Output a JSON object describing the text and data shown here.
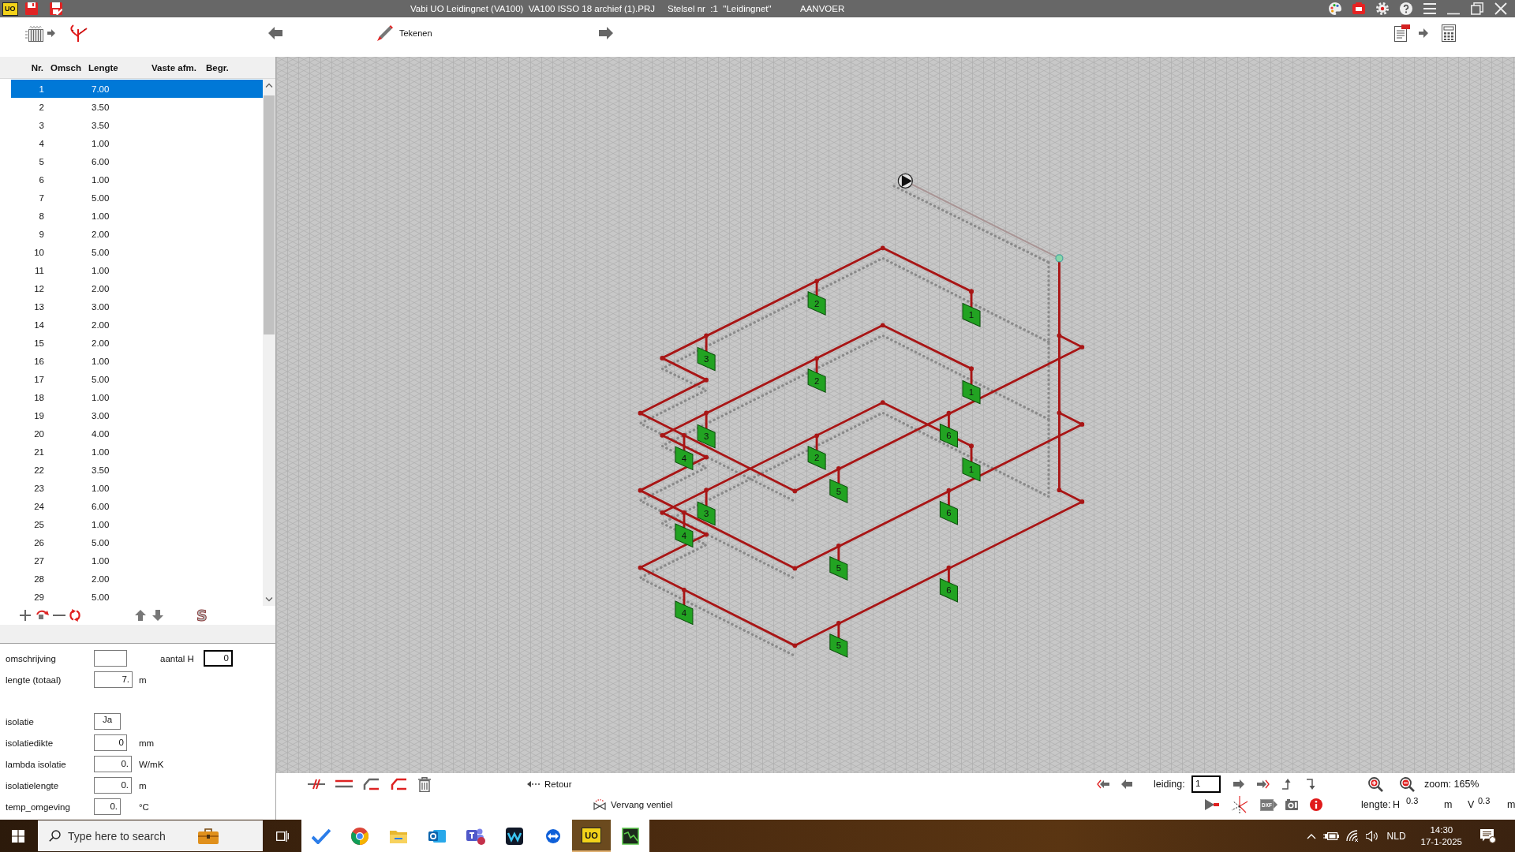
{
  "window": {
    "logo": "UO",
    "title": "Vabi UO Leidingnet (VA100)  VA100 ISSO 18 archief (1).PRJ",
    "system": "Stelsel nr  :1  \"Leidingnet\"",
    "flow": "AANVOER"
  },
  "toolbar": {
    "draw_button": "Tekenen"
  },
  "table": {
    "columns": [
      "Nr.",
      "Omsch",
      "Lengte",
      "Vaste afm.",
      "Begr."
    ],
    "rows": [
      {
        "nr": "1",
        "length": "7.00",
        "selected": true
      },
      {
        "nr": "2",
        "length": "3.50",
        "selected": false
      },
      {
        "nr": "3",
        "length": "3.50",
        "selected": false
      },
      {
        "nr": "4",
        "length": "1.00",
        "selected": false
      },
      {
        "nr": "5",
        "length": "6.00",
        "selected": false
      },
      {
        "nr": "6",
        "length": "1.00",
        "selected": false
      },
      {
        "nr": "7",
        "length": "5.00",
        "selected": false
      },
      {
        "nr": "8",
        "length": "1.00",
        "selected": false
      },
      {
        "nr": "9",
        "length": "2.00",
        "selected": false
      },
      {
        "nr": "10",
        "length": "5.00",
        "selected": false
      },
      {
        "nr": "11",
        "length": "1.00",
        "selected": false
      },
      {
        "nr": "12",
        "length": "2.00",
        "selected": false
      },
      {
        "nr": "13",
        "length": "3.00",
        "selected": false
      },
      {
        "nr": "14",
        "length": "2.00",
        "selected": false
      },
      {
        "nr": "15",
        "length": "2.00",
        "selected": false
      },
      {
        "nr": "16",
        "length": "1.00",
        "selected": false
      },
      {
        "nr": "17",
        "length": "5.00",
        "selected": false
      },
      {
        "nr": "18",
        "length": "1.00",
        "selected": false
      },
      {
        "nr": "19",
        "length": "3.00",
        "selected": false
      },
      {
        "nr": "20",
        "length": "4.00",
        "selected": false
      },
      {
        "nr": "21",
        "length": "1.00",
        "selected": false
      },
      {
        "nr": "22",
        "length": "3.50",
        "selected": false
      },
      {
        "nr": "23",
        "length": "1.00",
        "selected": false
      },
      {
        "nr": "24",
        "length": "6.00",
        "selected": false
      },
      {
        "nr": "25",
        "length": "1.00",
        "selected": false
      },
      {
        "nr": "26",
        "length": "5.00",
        "selected": false
      },
      {
        "nr": "27",
        "length": "1.00",
        "selected": false
      },
      {
        "nr": "28",
        "length": "2.00",
        "selected": false
      },
      {
        "nr": "29",
        "length": "5.00",
        "selected": false
      }
    ]
  },
  "list_tools": {
    "s_button": "S"
  },
  "form": {
    "general": [
      {
        "kind": "field",
        "label": "omschrijving",
        "extra": {
          "label": "aantal H",
          "value": "0"
        }
      },
      {
        "kind": "field",
        "label": "lengte (totaal)",
        "value": "7.",
        "unit": "m"
      }
    ],
    "insulation": [
      {
        "kind": "choice",
        "label": "isolatie",
        "value": "Ja"
      },
      {
        "kind": "field",
        "label": "isolatiedikte",
        "value": "0",
        "unit": "mm"
      },
      {
        "kind": "field",
        "label": "lambda isolatie",
        "value": "0.",
        "unit": "W/mK"
      },
      {
        "kind": "field",
        "label": "isolatielengte",
        "value": "0.",
        "unit": "m"
      },
      {
        "kind": "field",
        "label": "temp_omgeving",
        "value": "0.",
        "unit": "°C"
      }
    ]
  },
  "drawing": {
    "floors": [
      {
        "valves": [
          "3",
          "2",
          "1",
          "4",
          "5",
          "6"
        ]
      },
      {
        "valves": [
          "3",
          "2",
          "1",
          "4",
          "5",
          "6"
        ]
      },
      {
        "valves": [
          "3",
          "2",
          "1",
          "4",
          "5",
          "6"
        ]
      }
    ]
  },
  "bottom_toolbar": {
    "retour_button": "Retour",
    "replace_valve_button": "Vervang ventiel",
    "pipe": {
      "label": "leiding:",
      "value": "1"
    },
    "zoom": "zoom: 165%",
    "export_button": "DXF",
    "length": {
      "label": "lengte:",
      "h": {
        "label": "H",
        "value": "0.3",
        "unit": "m"
      },
      "v": {
        "label": "V",
        "value": "0.3",
        "unit": "m"
      }
    }
  },
  "taskbar": {
    "search_placeholder": "Type here to search",
    "apps": [
      {
        "kind": "tick",
        "active": false
      },
      {
        "kind": "browser",
        "active": false
      },
      {
        "kind": "folder",
        "active": false
      },
      {
        "kind": "mail",
        "active": false
      },
      {
        "kind": "chat",
        "active": false
      },
      {
        "kind": "wave",
        "active": false
      },
      {
        "kind": "remote",
        "active": false
      },
      {
        "kind": "logo",
        "label": "UO",
        "active": true
      },
      {
        "kind": "screen",
        "active": false
      }
    ],
    "language": "NLD",
    "time": "14:30",
    "date": "17-1-2025"
  }
}
